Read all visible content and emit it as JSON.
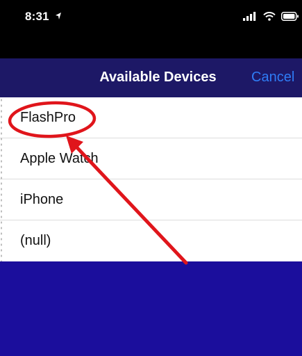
{
  "status_bar": {
    "time": "8:31",
    "location_icon": "location-arrow-icon",
    "signal_icon": "cellular-signal-icon",
    "wifi_icon": "wifi-icon",
    "battery_icon": "battery-icon"
  },
  "nav": {
    "title": "Available Devices",
    "cancel_label": "Cancel"
  },
  "devices": [
    {
      "label": "FlashPro"
    },
    {
      "label": "Apple Watch"
    },
    {
      "label": "iPhone"
    },
    {
      "label": "(null)"
    }
  ],
  "colors": {
    "background": "#1b0e9c",
    "nav_bar": "#1d1866",
    "cancel_accent": "#2f7cf6",
    "annotation_red": "#e0151b"
  },
  "annotation": {
    "circle_icon": "red-highlight-circle",
    "arrow_icon": "red-pointer-arrow"
  }
}
